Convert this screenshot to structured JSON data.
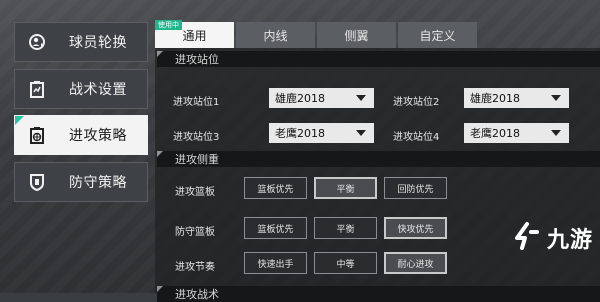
{
  "sidebar": {
    "items": [
      {
        "label": "球员轮换",
        "icon": "player-rotation-icon",
        "active": false
      },
      {
        "label": "战术设置",
        "icon": "tactics-clipboard-icon",
        "active": false
      },
      {
        "label": "进攻策略",
        "icon": "basketball-clipboard-icon",
        "active": true
      },
      {
        "label": "防守策略",
        "icon": "shield-icon",
        "active": false
      }
    ]
  },
  "tabs": {
    "badge": "使用中",
    "items": [
      {
        "label": "通用",
        "active": true
      },
      {
        "label": "内线",
        "active": false
      },
      {
        "label": "侧翼",
        "active": false
      },
      {
        "label": "自定义",
        "active": false
      }
    ]
  },
  "sections": {
    "positions": {
      "title": "进攻站位",
      "slots": [
        {
          "label": "进攻站位1",
          "value": "雄鹿2018"
        },
        {
          "label": "进攻站位2",
          "value": "雄鹿2018"
        },
        {
          "label": "进攻站位3",
          "value": "老鹰2018"
        },
        {
          "label": "进攻站位4",
          "value": "老鹰2018"
        }
      ]
    },
    "emphasis": {
      "title": "进攻侧重",
      "rows": [
        {
          "label": "进攻篮板",
          "options": [
            "篮板优先",
            "平衡",
            "回防优先"
          ],
          "selected": 1
        },
        {
          "label": "防守篮板",
          "options": [
            "篮板优先",
            "平衡",
            "快攻优先"
          ],
          "selected": 2
        },
        {
          "label": "进攻节奏",
          "options": [
            "快速出手",
            "中等",
            "耐心进攻"
          ],
          "selected": 2
        }
      ]
    },
    "next": {
      "title": "进攻战术"
    }
  },
  "watermark": {
    "text": "九游",
    "color": "#ffffff"
  },
  "colors": {
    "accent": "#27c6a0",
    "active_tab": "#f5f5f5"
  }
}
